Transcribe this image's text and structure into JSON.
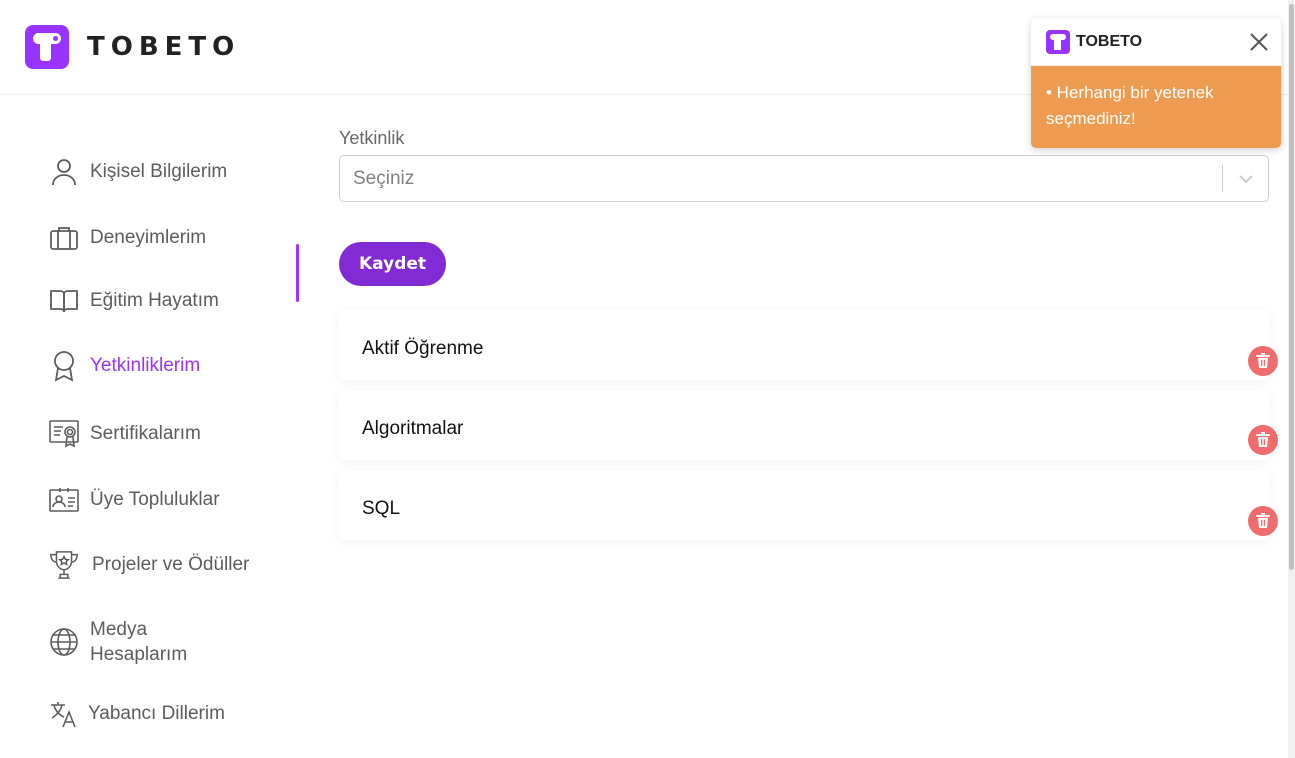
{
  "brand": {
    "name": "TOBETO",
    "accent": "#9933ff",
    "button_color": "#822ad4"
  },
  "sidebar": {
    "items": [
      {
        "label": "Kişisel Bilgilerim",
        "icon": "user-icon"
      },
      {
        "label": "Deneyimlerim",
        "icon": "briefcase-icon"
      },
      {
        "label": "Eğitim Hayatım",
        "icon": "book-icon"
      },
      {
        "label": "Yetkinliklerim",
        "icon": "award-icon",
        "active": true
      },
      {
        "label": "Sertifikalarım",
        "icon": "certificate-icon"
      },
      {
        "label": "Üye Topluluklar",
        "icon": "id-card-icon"
      },
      {
        "label": "Projeler ve Ödüller",
        "icon": "trophy-icon"
      },
      {
        "label_line1": "Medya",
        "label_line2": "Hesaplarım",
        "icon": "globe-icon"
      },
      {
        "label": "Yabancı Dillerim",
        "icon": "translate-icon"
      }
    ]
  },
  "form": {
    "label": "Yetkinlik",
    "select_value": "Seçiniz",
    "save_label": "Kaydet"
  },
  "skills": [
    {
      "name": "Aktif Öğrenme"
    },
    {
      "name": "Algoritmalar"
    },
    {
      "name": "SQL"
    }
  ],
  "toast": {
    "title": "TOBETO",
    "message": "• Herhangi bir yetenek seçmediniz!",
    "color": "#ed9b51"
  }
}
